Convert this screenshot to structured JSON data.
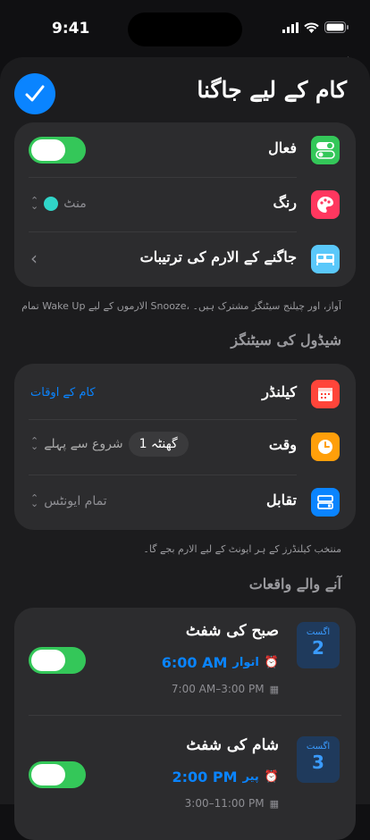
{
  "status": {
    "time": "9:41"
  },
  "sheet": {
    "title": "کام کے لیے جاگنا"
  },
  "general": {
    "active_label": "فعال",
    "color_label": "رنگ",
    "color_value": "منٹ",
    "alarm_settings_label": "جاگنے کے الارم کی ترتیبات"
  },
  "general_footnote": "تمام Wake Up الارموں کے لیے Snooze، آواز، اور چیلنج سیٹنگز مشترک ہیں۔",
  "schedule": {
    "header": "شیڈول کی سیٹنگز",
    "calendar_label": "کیلنڈر",
    "calendar_value": "کام کے اوقات",
    "time_label": "وقت",
    "time_value": "1 گھنٹہ",
    "time_suffix": "شروع سے پہلے",
    "matching_label": "تقابل",
    "matching_value": "تمام ایونٹس"
  },
  "schedule_footnote": "منتخب کیلنڈرز کے ہر ایونٹ کے لیے الارم بجے گا۔",
  "upcoming": {
    "header": "آنے والے واقعات",
    "events": [
      {
        "month": "اگست",
        "day": "2",
        "title": "صبح کی شفٹ",
        "alarm_time": "6:00 AM",
        "alarm_day": "اتوار",
        "range": "7:00 AM–3:00 PM"
      },
      {
        "month": "اگست",
        "day": "3",
        "title": "شام کی شفٹ",
        "alarm_time": "2:00 PM",
        "alarm_day": "پیر",
        "range": "3:00–11:00 PM"
      }
    ]
  },
  "colors": {
    "accent": "#0a84ff",
    "toggle_on": "#34c759",
    "mint": "#30d5c8"
  }
}
